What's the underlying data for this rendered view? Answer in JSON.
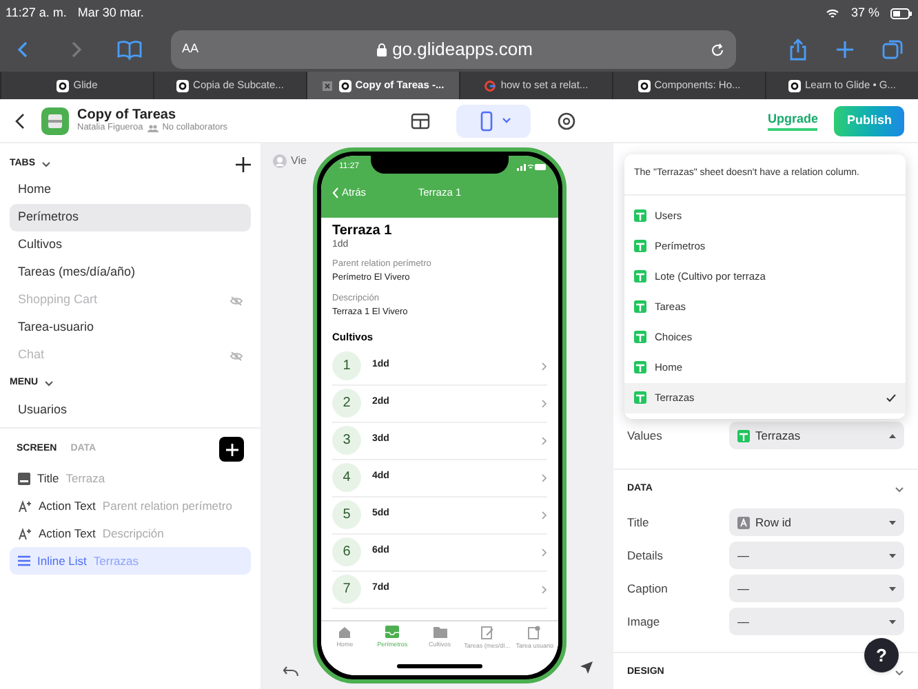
{
  "status_bar": {
    "time": "11:27 a. m.",
    "date": "Mar 30 mar.",
    "battery": "37 %"
  },
  "browser": {
    "reader_label": "AA",
    "url": "go.glideapps.com",
    "tabs": [
      {
        "label": "Glide",
        "kind": "glide",
        "selected": false
      },
      {
        "label": "Copia de Subcate...",
        "kind": "glide",
        "selected": false
      },
      {
        "label": "Copy of Tareas -...",
        "kind": "glide",
        "selected": true
      },
      {
        "label": "how to set a relat...",
        "kind": "google",
        "selected": false
      },
      {
        "label": "Components: Ho...",
        "kind": "glide",
        "selected": false
      },
      {
        "label": "Learn to Glide • G...",
        "kind": "glide",
        "selected": false
      }
    ]
  },
  "app_header": {
    "title": "Copy of Tareas",
    "owner": "Natalia Figueroa",
    "collaborators": "No collaborators",
    "view_modes": [
      {
        "kind": "data",
        "selected": false
      },
      {
        "kind": "layout",
        "selected": true
      },
      {
        "kind": "settings",
        "selected": false
      }
    ],
    "upgrade": "Upgrade",
    "publish": "Publish"
  },
  "sidebar": {
    "tabs_heading": "TABS",
    "tabs": [
      {
        "label": "Home",
        "selected": false,
        "hidden": false
      },
      {
        "label": "Perímetros",
        "selected": true,
        "hidden": false
      },
      {
        "label": "Cultivos",
        "selected": false,
        "hidden": false
      },
      {
        "label": "Tareas (mes/día/año)",
        "selected": false,
        "hidden": false
      },
      {
        "label": "Shopping Cart",
        "selected": false,
        "hidden": true
      },
      {
        "label": "Tarea-usuario",
        "selected": false,
        "hidden": false
      },
      {
        "label": "Chat",
        "selected": false,
        "hidden": true
      }
    ],
    "menu_heading": "MENU",
    "menu": [
      {
        "label": "Usuarios",
        "selected": false,
        "hidden": false
      }
    ],
    "screen_tabs": [
      {
        "label": "SCREEN",
        "selected": true
      },
      {
        "label": "DATA",
        "selected": false
      }
    ],
    "components": [
      {
        "kind": "title",
        "name": "Title",
        "value": "Terraza",
        "selected": false
      },
      {
        "kind": "action_text",
        "name": "Action Text",
        "value": "Parent relation perímetro",
        "selected": false
      },
      {
        "kind": "action_text",
        "name": "Action Text",
        "value": "Descripción",
        "selected": false
      },
      {
        "kind": "inline_list",
        "name": "Inline List",
        "value": "Terrazas",
        "selected": true
      }
    ]
  },
  "canvas": {
    "viewer_label": "Vie"
  },
  "phone": {
    "time": "11:27",
    "back": "Atrás",
    "nav_title": "Terraza 1",
    "heading": "Terraza 1",
    "subtitle": "1dd",
    "fields": [
      {
        "label": "Parent relation perímetro",
        "value": "Perímetro El Vivero"
      },
      {
        "label": "Descripción",
        "value": "Terraza 1 El Vivero"
      }
    ],
    "list_title": "Cultivos",
    "list": [
      {
        "number": "1",
        "text": "1dd"
      },
      {
        "number": "2",
        "text": "2dd"
      },
      {
        "number": "3",
        "text": "3dd"
      },
      {
        "number": "4",
        "text": "4dd"
      },
      {
        "number": "5",
        "text": "5dd"
      },
      {
        "number": "6",
        "text": "6dd"
      },
      {
        "number": "7",
        "text": "7dd"
      }
    ],
    "tab_bar": [
      {
        "label": "Home",
        "kind": "home",
        "selected": false
      },
      {
        "label": "Perímetros",
        "kind": "inbox",
        "selected": true
      },
      {
        "label": "Cultivos",
        "kind": "folder",
        "selected": false
      },
      {
        "label": "Tareas (mes/dí...",
        "kind": "clipboard",
        "selected": false
      },
      {
        "label": "Tarea usuario",
        "kind": "tasks",
        "selected": false
      }
    ]
  },
  "right_panel": {
    "dropdown": {
      "message": "The \"Terrazas\" sheet doesn't have a relation column.",
      "options": [
        {
          "label": "Users",
          "selected": false
        },
        {
          "label": "Perímetros",
          "selected": false
        },
        {
          "label": "Lote (Cultivo por terraza",
          "selected": false
        },
        {
          "label": "Tareas",
          "selected": false
        },
        {
          "label": "Choices",
          "selected": false
        },
        {
          "label": "Home",
          "selected": false
        },
        {
          "label": "Terrazas",
          "selected": true
        }
      ]
    },
    "values": {
      "label": "Values",
      "value": "Terrazas"
    },
    "data_heading": "DATA",
    "data_rows": [
      {
        "label": "Title",
        "value": "Row id",
        "kind": "column"
      },
      {
        "label": "Details",
        "value": "—",
        "kind": "empty"
      },
      {
        "label": "Caption",
        "value": "—",
        "kind": "empty"
      },
      {
        "label": "Image",
        "value": "—",
        "kind": "empty"
      }
    ],
    "design_heading": "DESIGN",
    "help": "?"
  }
}
